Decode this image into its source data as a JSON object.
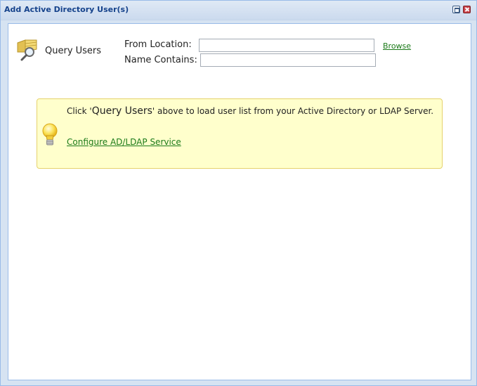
{
  "window": {
    "title": "Add Active Directory User(s)",
    "colors": {
      "title_text": "#15428b",
      "frame": "#99bbe8",
      "link": "#1b7a19",
      "hint_bg": "#ffffcc",
      "hint_border": "#e6d26c"
    }
  },
  "toolbar": {
    "query_label": "Query Users",
    "query_icon": "magnifier-on-folder-icon"
  },
  "form": {
    "from_location_label": "From Location:",
    "from_location_value": "",
    "name_contains_label": "Name Contains:",
    "name_contains_value": "",
    "browse_label": "Browse"
  },
  "hint": {
    "icon": "lightbulb-icon",
    "prefix": "Click '",
    "query_users": "Query Users",
    "suffix": "' above to load user list from your Active Directory or LDAP Server.",
    "configure_link": "Configure AD/LDAP Service"
  }
}
